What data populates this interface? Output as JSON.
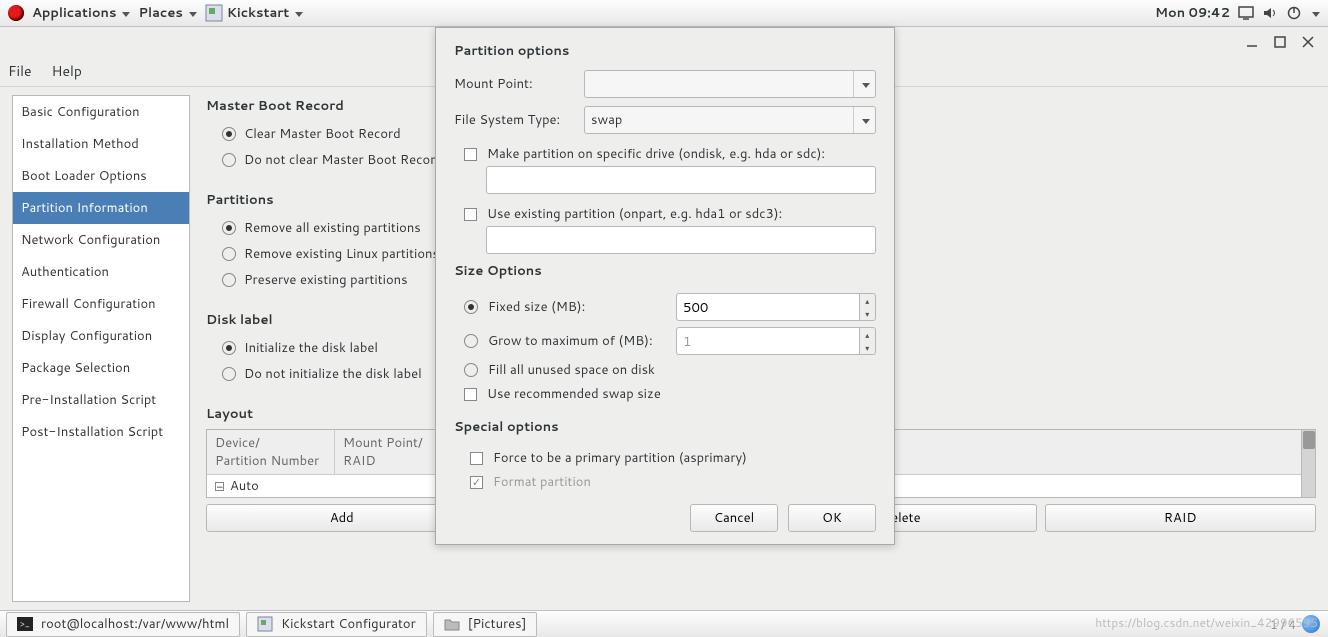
{
  "panel": {
    "applications": "Applications",
    "places": "Places",
    "activeApp": "Kickstart",
    "clock": "Mon 09:42"
  },
  "menubar": {
    "file": "File",
    "help": "Help"
  },
  "sidebar": {
    "items": [
      "Basic Configuration",
      "Installation Method",
      "Boot Loader Options",
      "Partition Information",
      "Network Configuration",
      "Authentication",
      "Firewall Configuration",
      "Display Configuration",
      "Package Selection",
      "Pre-Installation Script",
      "Post-Installation Script"
    ],
    "selectedIndex": 3
  },
  "mbr": {
    "heading": "Master Boot Record",
    "clear": "Clear Master Boot Record",
    "noclear": "Do not clear Master Boot Record"
  },
  "partitions": {
    "heading": "Partitions",
    "removeAll": "Remove all existing partitions",
    "removeLinux": "Remove existing Linux partitions",
    "preserve": "Preserve existing partitions"
  },
  "disklabel": {
    "heading": "Disk label",
    "init": "Initialize the disk label",
    "noinit": "Do not initialize the disk label"
  },
  "layout": {
    "heading": "Layout",
    "col1a": "Device/",
    "col1b": "Partition Number",
    "col2a": "Mount Point/",
    "col2b": "RAID",
    "autoRow": "Auto"
  },
  "buttons": {
    "add": "Add",
    "delete": "Delete",
    "raid": "RAID"
  },
  "dialog": {
    "title": "Partition options",
    "mountPoint": "Mount Point:",
    "fsType": "File System Type:",
    "fsTypeValue": "swap",
    "ondisk": "Make partition on specific drive (ondisk, e.g. hda or sdc):",
    "onpart": "Use existing partition (onpart, e.g. hda1 or sdc3):",
    "sizeHeading": "Size Options",
    "fixed": "Fixed size (MB):",
    "fixedValue": "500",
    "grow": "Grow to maximum of (MB):",
    "growValue": "1",
    "fill": "Fill all unused space on disk",
    "recswap": "Use recommended swap size",
    "specialHeading": "Special options",
    "asprimary": "Force to be a primary partition (asprimary)",
    "format": "Format partition",
    "cancel": "Cancel",
    "ok": "OK"
  },
  "taskbar": {
    "terminal": "root@localhost:/var/www/html",
    "kickstart": "Kickstart Configurator",
    "pictures": "[Pictures]"
  },
  "watermark": "https://blog.csdn.net/weixin_42996595",
  "pager": "1 / 4"
}
